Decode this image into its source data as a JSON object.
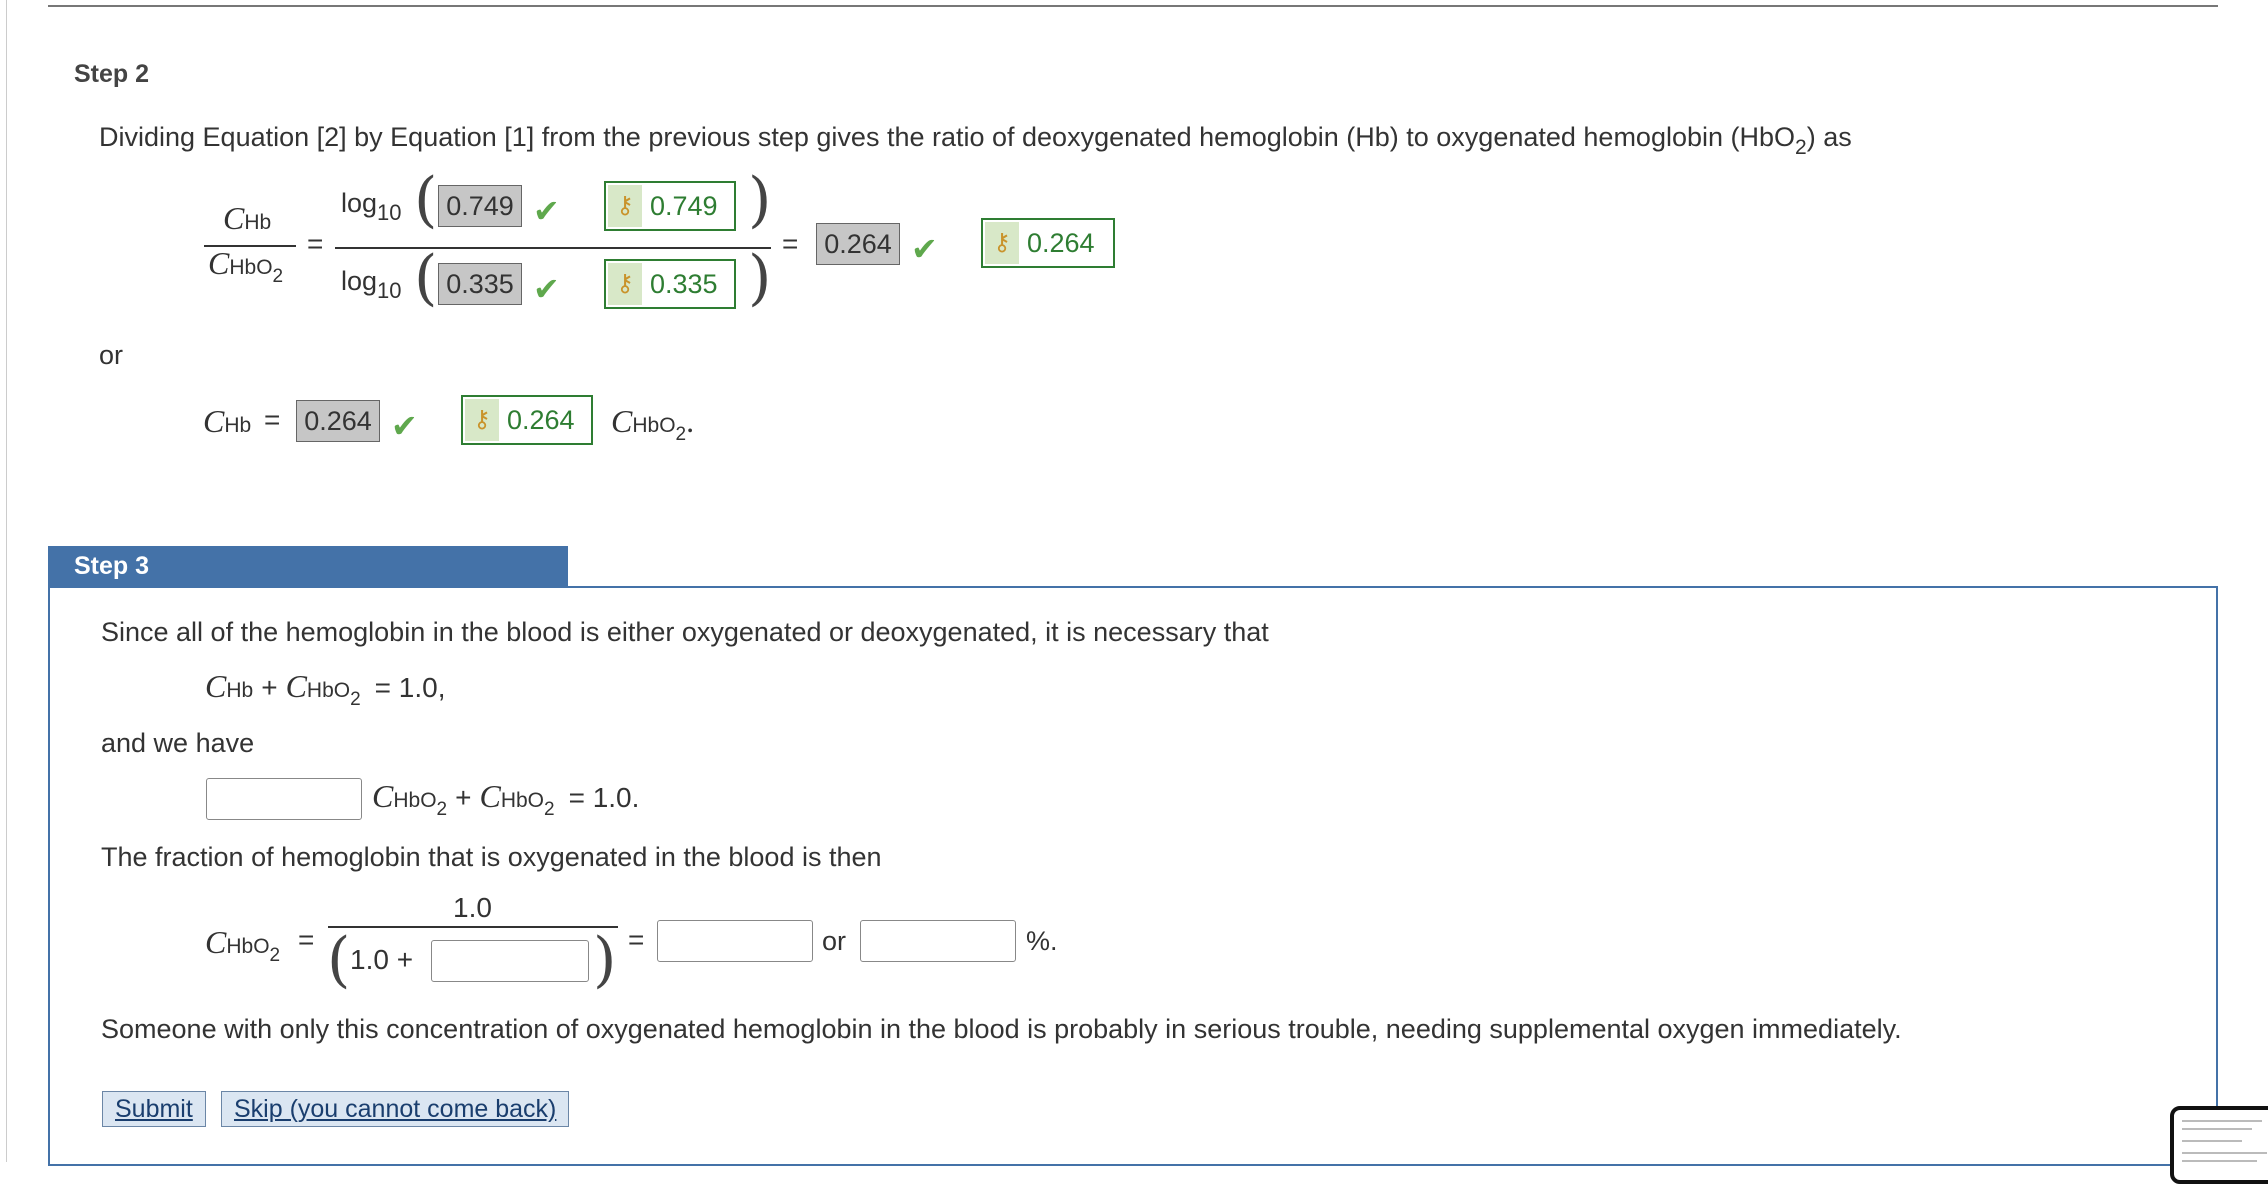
{
  "step2": {
    "title": "Step 2",
    "intro_main": "Dividing Equation [2] by Equation [1] from the previous step gives the ratio of deoxygenated hemoglobin (Hb) to oxygenated hemoglobin (HbO",
    "intro_sub": "2",
    "intro_end": ") as",
    "c_sym": "C",
    "hb_sub": "Hb",
    "hbo_sub": "HbO",
    "two": "2",
    "equals": "=",
    "log": "log",
    "log_base": "10",
    "numerator_answer": "0.749",
    "numerator_key": "0.749",
    "denominator_answer": "0.335",
    "denominator_key": "0.335",
    "ratio_answer": "0.264",
    "ratio_key": "0.264",
    "or_label": "or",
    "chb_answer": "0.264",
    "chb_key": "0.264",
    "period": "."
  },
  "step3": {
    "title": "Step 3",
    "line1": "Since all of the hemoglobin in the blood is either oxygenated or deoxygenated, it is necessary that",
    "plus": "+",
    "eq_one_comma": "= 1.0,",
    "and_we_have": "and we have",
    "eq_one_period": "= 1.0.",
    "fraction_text": "The fraction of hemoglobin that is oxygenated in the blood is then",
    "numerator": "1.0",
    "denom_prefix": "1.0 +",
    "or_label": "or",
    "percent": "%.",
    "closing": "Someone with only this concentration of oxygenated hemoglobin in the blood is probably in serious trouble, needing supplemental oxygen immediately.",
    "inputs": {
      "coefficient": "",
      "denominator_term": "",
      "fraction_value": "",
      "percent_value": ""
    }
  },
  "buttons": {
    "submit": "Submit",
    "skip": "Skip (you cannot come back)"
  },
  "icons": {
    "check": "checkmark-icon",
    "key": "key-icon"
  }
}
